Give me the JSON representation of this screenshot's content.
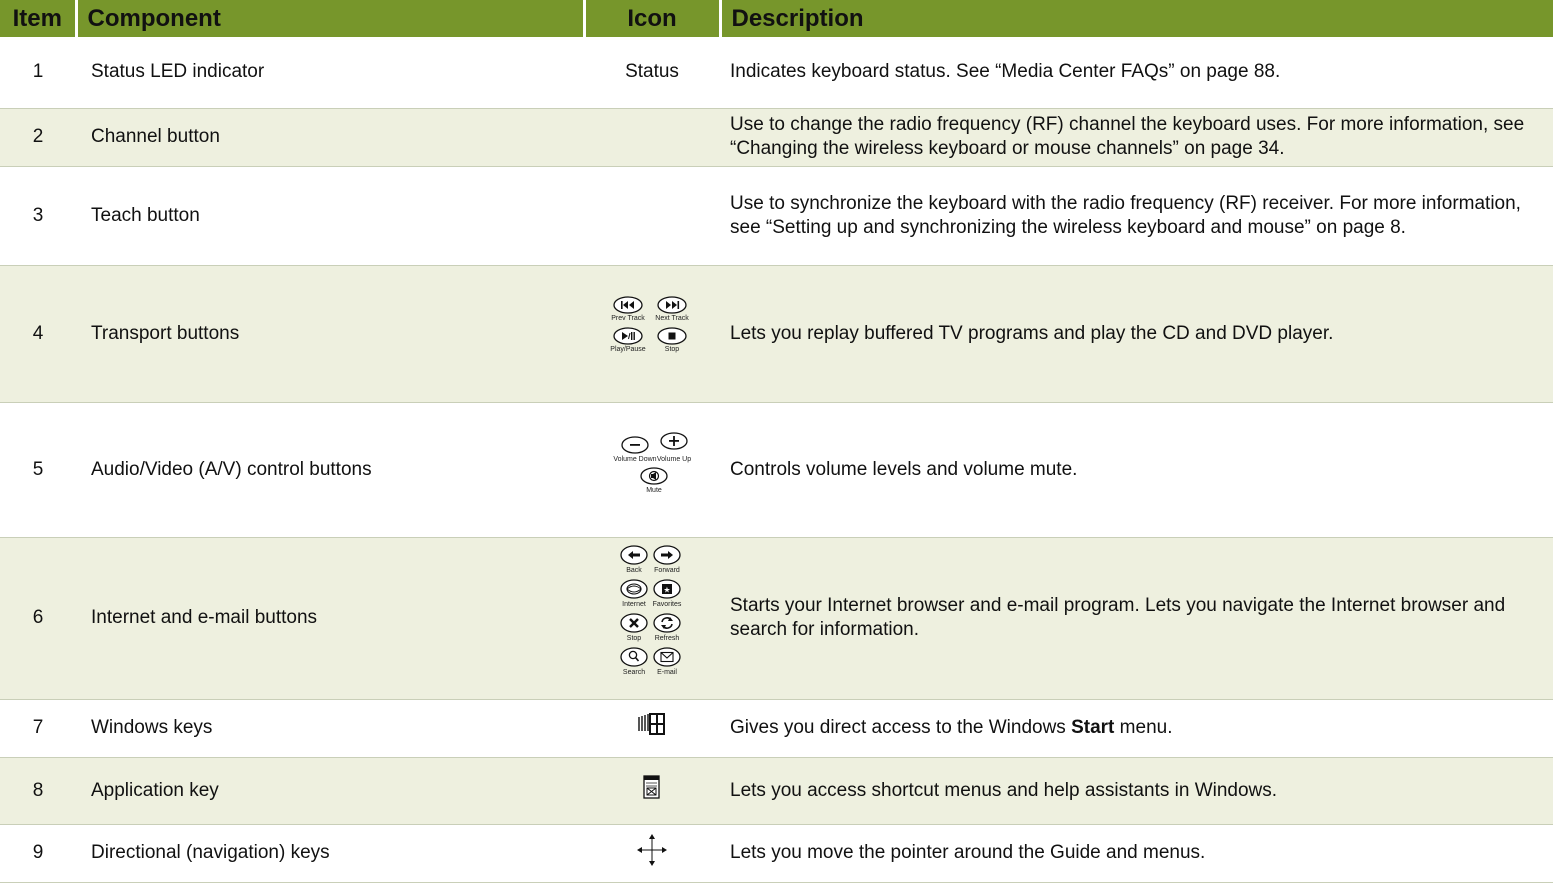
{
  "header": {
    "item": "Item",
    "component": "Component",
    "icon": "Icon",
    "description": "Description"
  },
  "rows": [
    {
      "item": "1",
      "component": "Status LED indicator",
      "icon_text": "Status",
      "description": "Indicates keyboard status. See “Media Center FAQs” on page 88."
    },
    {
      "item": "2",
      "component": "Channel button",
      "description": "Use to change the radio frequency (RF) channel the keyboard uses. For more information, see “Changing the wireless keyboard or mouse channels” on page 34."
    },
    {
      "item": "3",
      "component": "Teach button",
      "description": "Use to synchronize the keyboard with the radio frequency (RF) receiver. For more information, see “Setting up and synchronizing the wireless keyboard and mouse” on page 8."
    },
    {
      "item": "4",
      "component": "Transport buttons",
      "icon_labels": [
        "Prev Track",
        "Next Track",
        "Play/Pause",
        "Stop"
      ],
      "description": "Lets you replay buffered TV programs and play the CD and DVD player."
    },
    {
      "item": "5",
      "component": "Audio/Video (A/V) control buttons",
      "icon_labels": [
        "Volume Down",
        "Volume Up",
        "Mute"
      ],
      "description": "Controls volume levels and volume mute."
    },
    {
      "item": "6",
      "component": "Internet and e-mail buttons",
      "icon_labels": [
        "Back",
        "Forward",
        "Internet",
        "Favorites",
        "Stop",
        "Refresh",
        "Search",
        "E-mail"
      ],
      "description": "Starts your Internet browser and e-mail program. Lets you navigate the Internet browser and search for information."
    },
    {
      "item": "7",
      "component": "Windows keys",
      "description_before": "Gives you direct access to the Windows ",
      "description_bold": "Start",
      "description_after": " menu."
    },
    {
      "item": "8",
      "component": "Application key",
      "description": "Lets you access shortcut menus and help assistants in Windows."
    },
    {
      "item": "9",
      "component": "Directional (navigation) keys",
      "description": "Lets you move the pointer around the Guide and menus."
    }
  ],
  "icons": {
    "row4": [
      "prev-track-icon",
      "next-track-icon",
      "play-pause-icon",
      "stop-icon"
    ],
    "row5": [
      "volume-down-icon",
      "volume-up-icon",
      "mute-icon"
    ],
    "row6": [
      "back-icon",
      "forward-icon",
      "internet-icon",
      "favorites-icon",
      "stop-icon",
      "refresh-icon",
      "search-icon",
      "email-icon"
    ],
    "row7": "windows-logo-icon",
    "row8": "application-key-icon",
    "row9": "directional-arrows-icon"
  },
  "colors": {
    "header_bg": "#77962b",
    "alt_row_bg": "#eef0df"
  }
}
